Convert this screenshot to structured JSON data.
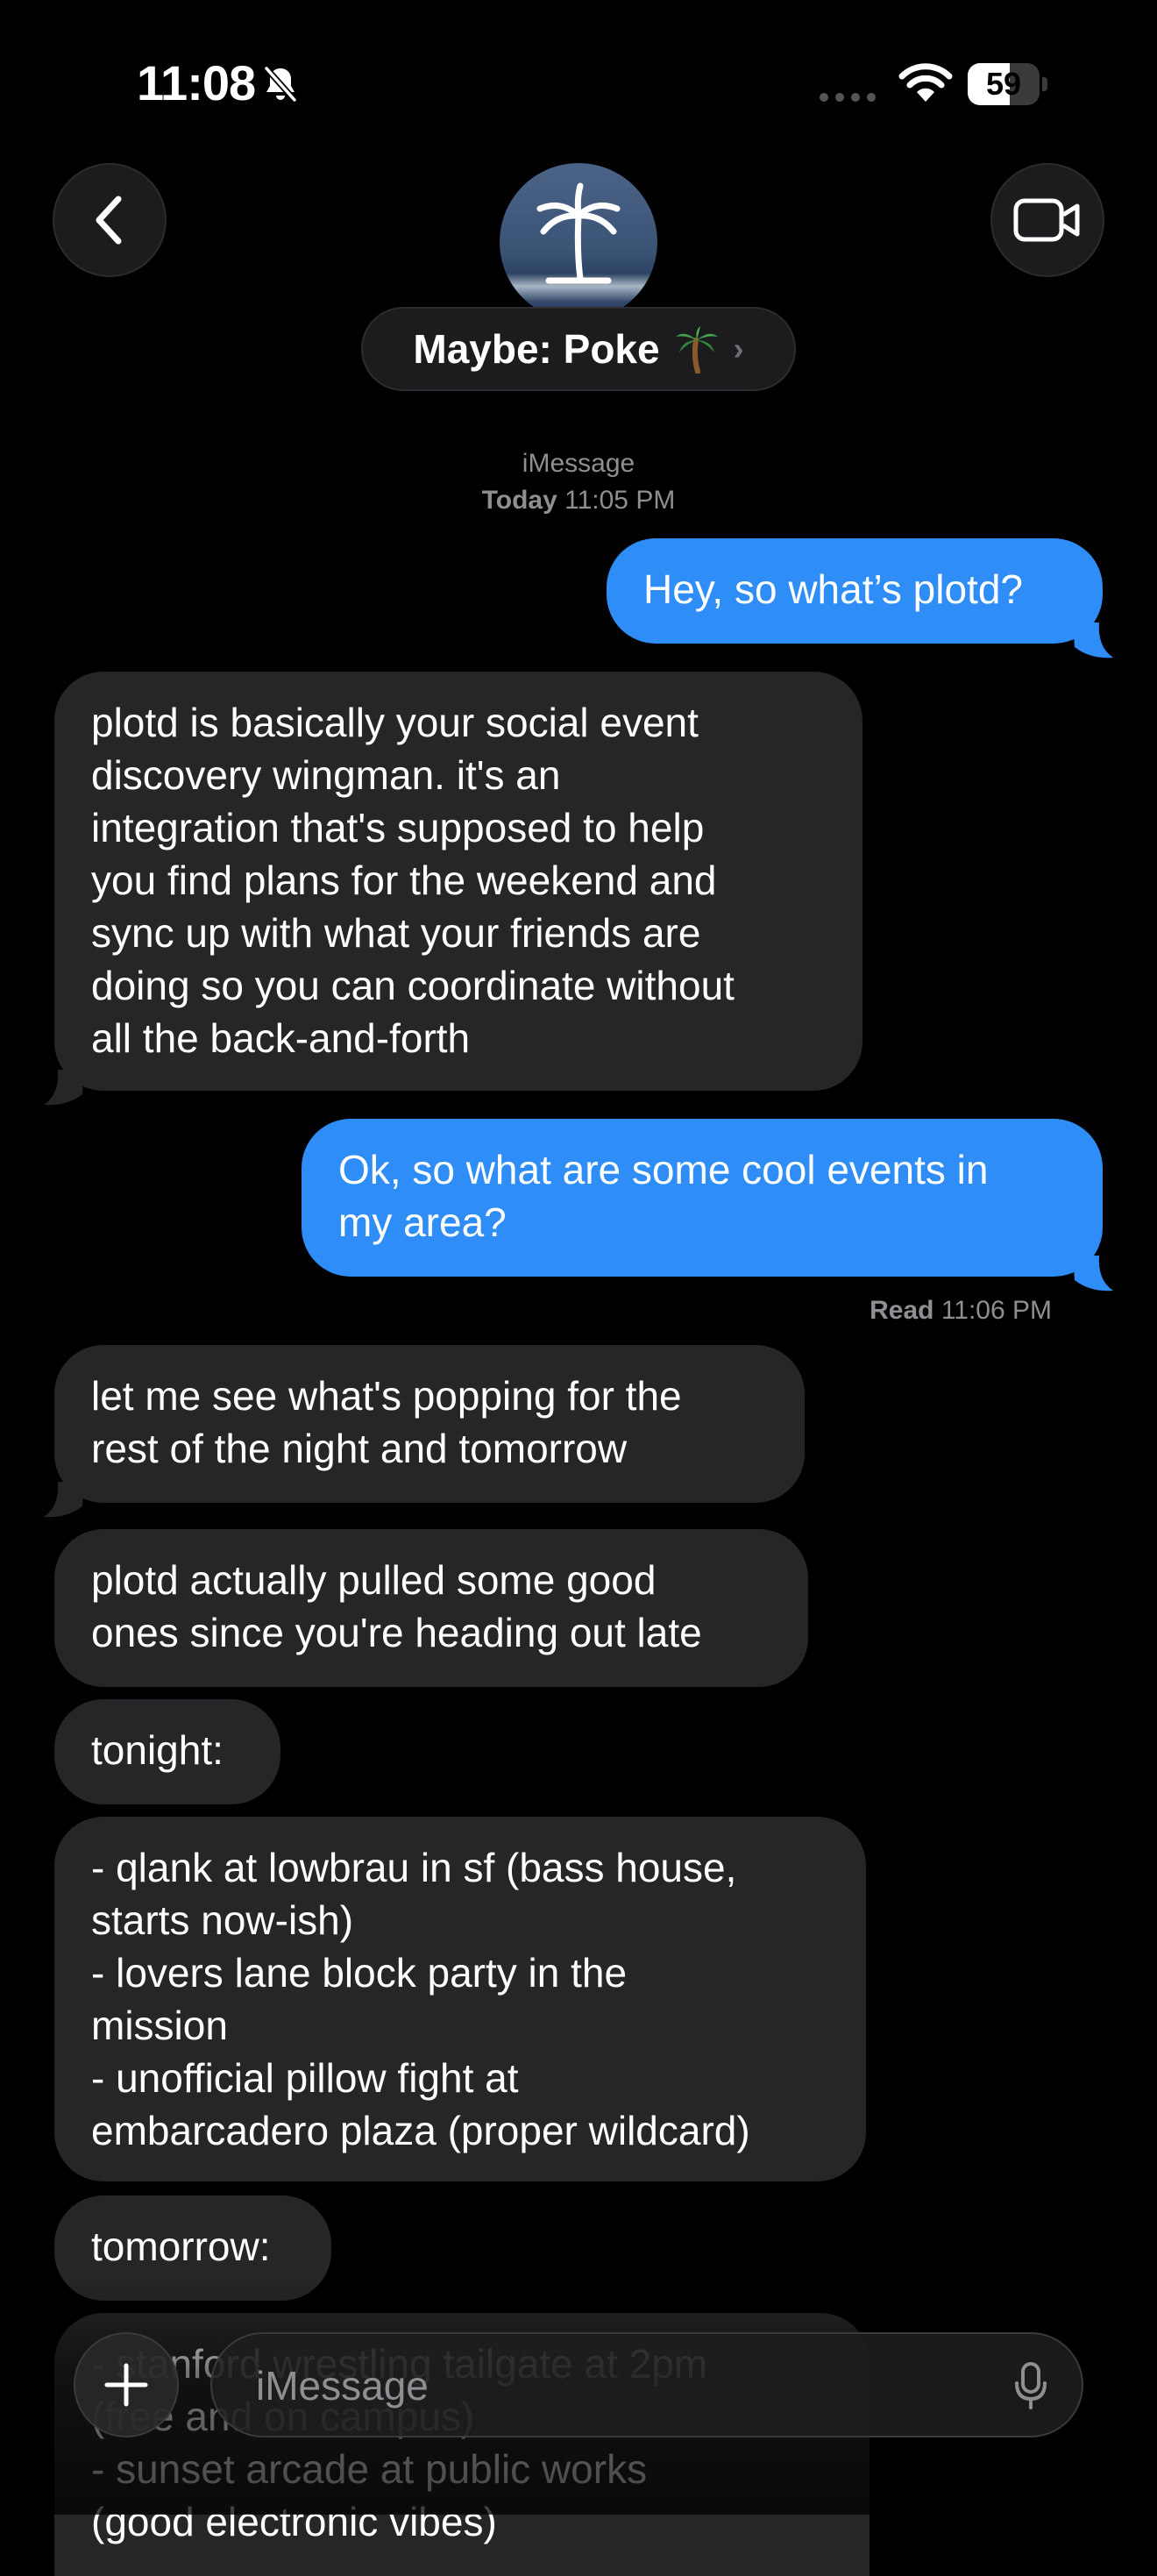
{
  "status_bar": {
    "time": "11:08",
    "battery": "59",
    "battery_level": 0.59
  },
  "header": {
    "contact_name": "Maybe: Poke",
    "contact_emoji_icon": "palm-tree-icon",
    "avatar_icon": "palm-tree-icon"
  },
  "conversation_meta": {
    "service": "iMessage",
    "day": "Today",
    "time": "11:05 PM"
  },
  "messages": [
    {
      "from": "me",
      "text": "Hey, so what’s plotd?"
    },
    {
      "from": "them",
      "text": "plotd is basically your social event\ndiscovery wingman. it's an\nintegration that's supposed to help\nyou find plans for the weekend and\nsync up with what your friends are\ndoing so you can coordinate without\nall the back-and-forth"
    },
    {
      "from": "me",
      "text": "Ok, so what are some cool events in\nmy area?"
    },
    {
      "from": "them",
      "text": "let me see what's popping for the\nrest of the night and tomorrow"
    },
    {
      "from": "them",
      "text": "plotd actually pulled some good\nones since you're heading out late"
    },
    {
      "from": "them",
      "text": "tonight:"
    },
    {
      "from": "them",
      "text": "- qlank at lowbrau in sf (bass house,\nstarts now-ish)\n- lovers lane block party in the\nmission\n- unofficial pillow fight at\nembarcadero plaza (proper wildcard)"
    },
    {
      "from": "them",
      "text": "tomorrow:"
    },
    {
      "from": "them",
      "text": "- stanford wrestling tailgate at 2pm\n(free and on campus)\n- sunset arcade at public works\n(good electronic vibes)"
    }
  ],
  "read_receipt": {
    "label": "Read",
    "time": "11:06 PM"
  },
  "composer": {
    "placeholder": "iMessage"
  },
  "colors": {
    "outgoing_bubble": "#2f8df7",
    "incoming_bubble": "#262628",
    "background": "#000000"
  }
}
